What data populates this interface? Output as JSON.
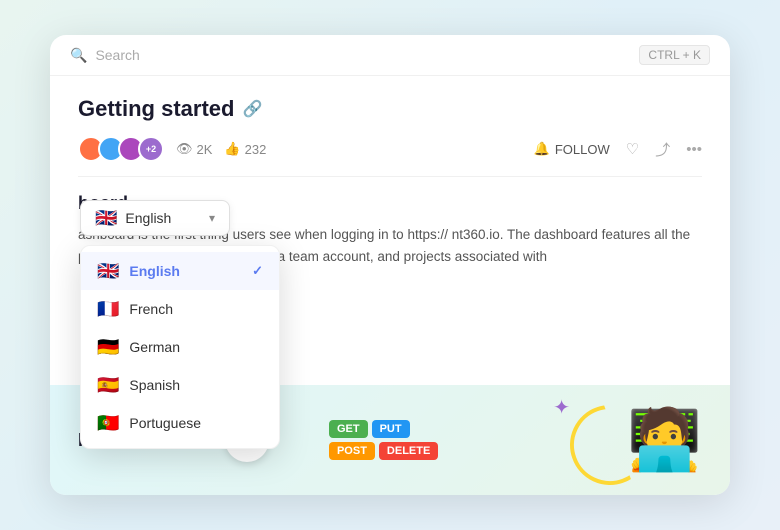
{
  "search": {
    "placeholder": "Search",
    "shortcut": "CTRL + K"
  },
  "article": {
    "title": "Getting started",
    "views": "2K",
    "likes": "232",
    "follow_label": "FOLLOW",
    "section_title": "board",
    "body": "ashboard is the first thing users see when logging in to https://\nnt360.io. The dashboard features all the projects the user\nassociated with a team account, and projects associated with",
    "intro_label": "Introduction to"
  },
  "avatars": [
    {
      "label": "",
      "color": "#ff7043"
    },
    {
      "label": "",
      "color": "#42a5f5"
    },
    {
      "label": "",
      "color": "#ab47bc"
    }
  ],
  "avatar_more": "+2",
  "language_trigger": {
    "label": "English",
    "chevron": "▾"
  },
  "languages": [
    {
      "code": "en",
      "flag": "🇬🇧",
      "label": "English",
      "active": true
    },
    {
      "code": "fr",
      "flag": "🇫🇷",
      "label": "French",
      "active": false
    },
    {
      "code": "de",
      "flag": "🇩🇪",
      "label": "German",
      "active": false
    },
    {
      "code": "es",
      "flag": "🇪🇸",
      "label": "Spanish",
      "active": false
    },
    {
      "code": "pt",
      "flag": "🇵🇹",
      "label": "Portuguese",
      "active": false
    }
  ],
  "api_tags": {
    "get": "GET",
    "put": "PUT",
    "post": "POST",
    "delete": "DELETE"
  },
  "icons": {
    "search": "🔍",
    "link": "🔗",
    "eye": "👁",
    "thumb": "👍",
    "bell": "🔔",
    "heart": "♡",
    "share": "⤴",
    "more": "•••",
    "play": "▶",
    "plus": "+"
  }
}
